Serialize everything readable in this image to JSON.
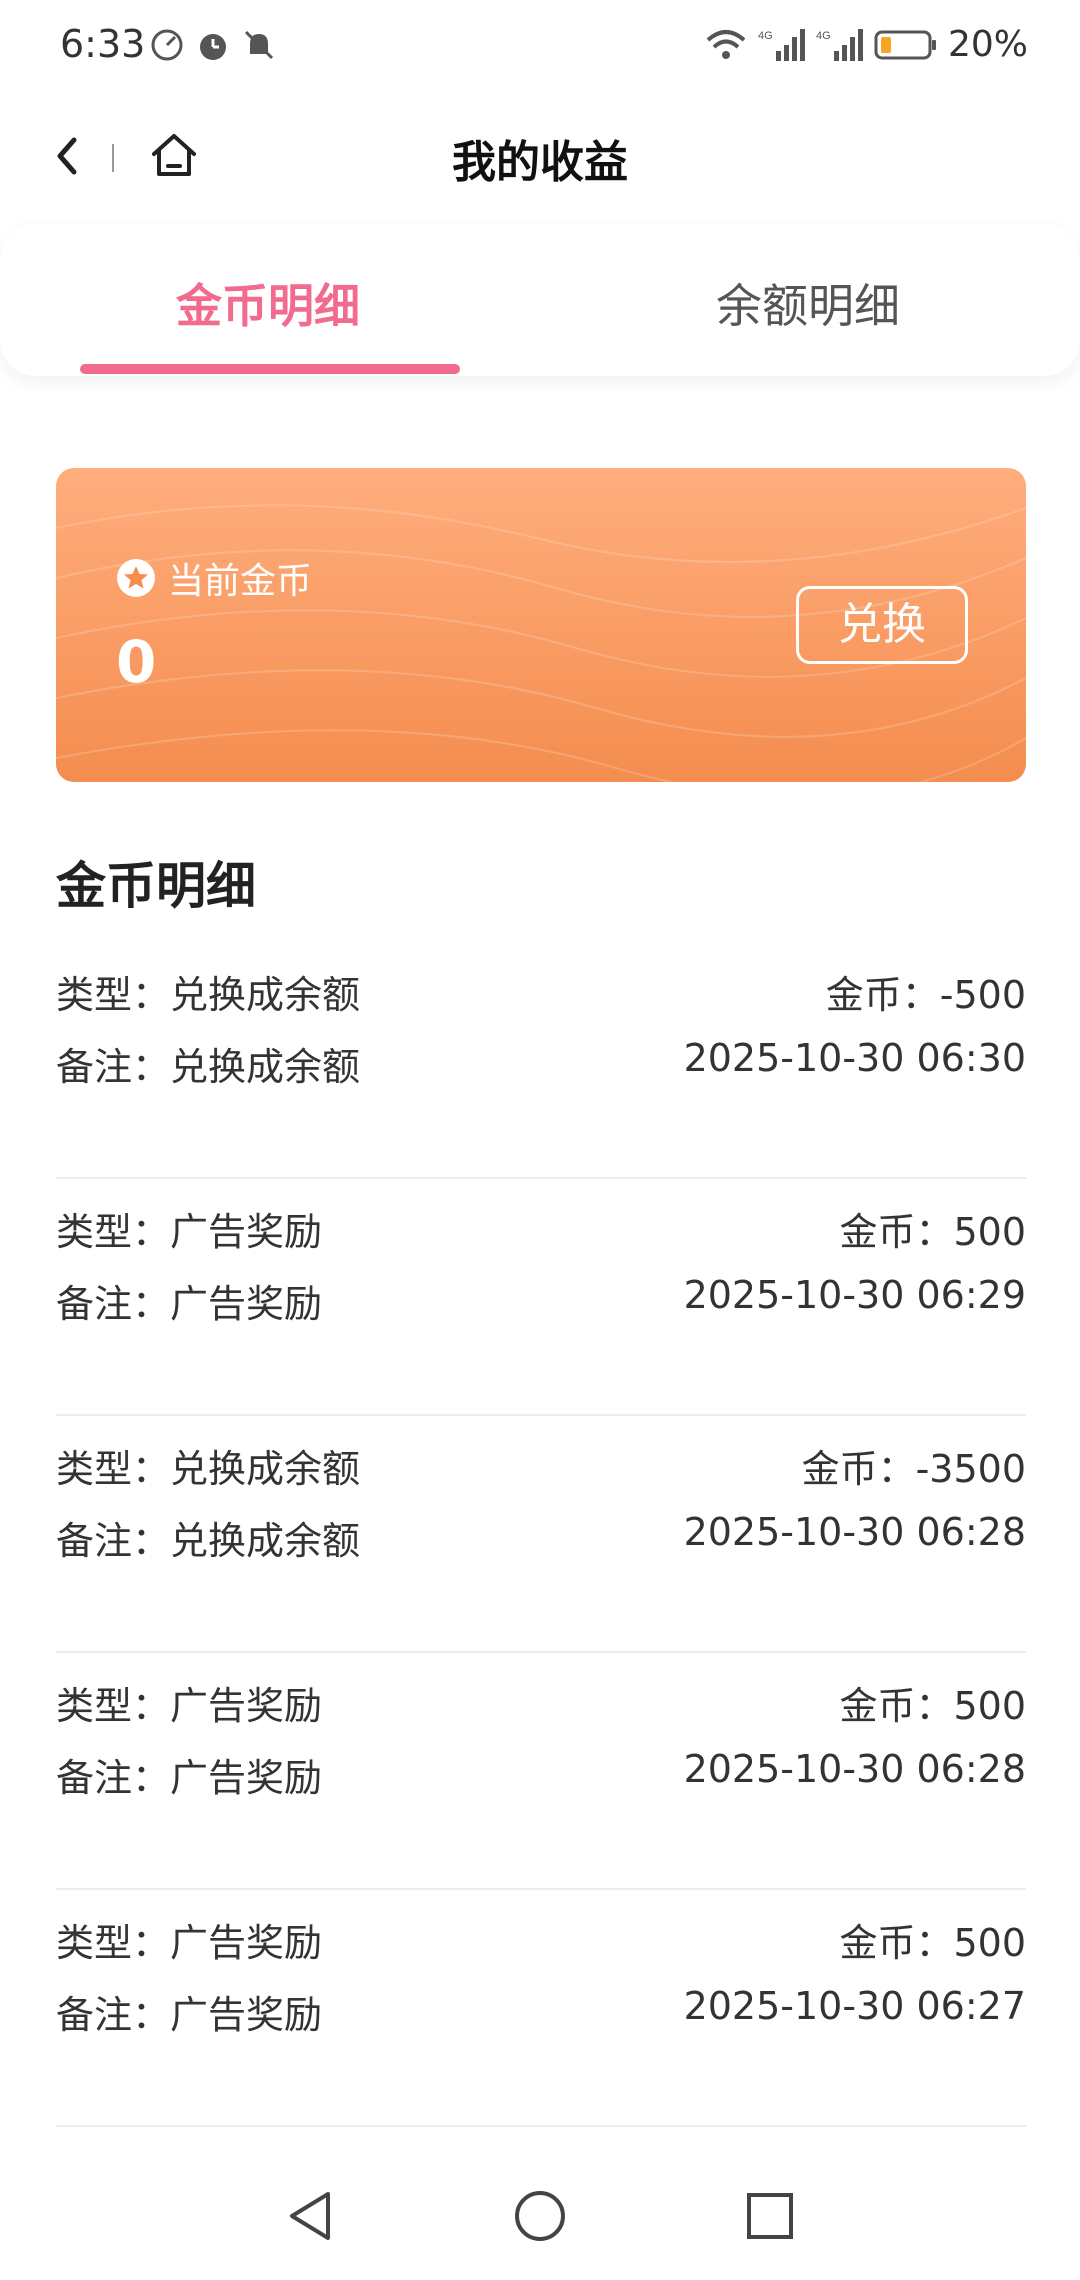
{
  "status": {
    "time": "6:33",
    "battery_text": "20%",
    "network": "4G"
  },
  "header": {
    "title": "我的收益"
  },
  "tabs": [
    {
      "label": "金币明细",
      "active": true
    },
    {
      "label": "余额明细",
      "active": false
    }
  ],
  "card": {
    "label": "当前金币",
    "value": "0",
    "exchange_label": "兑换"
  },
  "section_title": "金币明细",
  "records": [
    {
      "type": "类型：兑换成余额",
      "coins": "金币：-500",
      "note": "备注：兑换成余额",
      "time": "2025-10-30 06:30"
    },
    {
      "type": "类型：广告奖励",
      "coins": "金币：500",
      "note": "备注：广告奖励",
      "time": "2025-10-30 06:29"
    },
    {
      "type": "类型：兑换成余额",
      "coins": "金币：-3500",
      "note": "备注：兑换成余额",
      "time": "2025-10-30 06:28"
    },
    {
      "type": "类型：广告奖励",
      "coins": "金币：500",
      "note": "备注：广告奖励",
      "time": "2025-10-30 06:28"
    },
    {
      "type": "类型：广告奖励",
      "coins": "金币：500",
      "note": "备注：广告奖励",
      "time": "2025-10-30 06:27"
    }
  ],
  "colors": {
    "accent": "#f26a8d",
    "card_top": "#ffae7d",
    "card_bottom": "#f48d4f"
  },
  "icons": {
    "back": "chevron-left-icon",
    "home": "home-icon",
    "coin": "star-circle-icon",
    "nav_back": "triangle-back-icon",
    "nav_home": "circle-home-icon",
    "nav_recent": "square-recent-icon"
  }
}
